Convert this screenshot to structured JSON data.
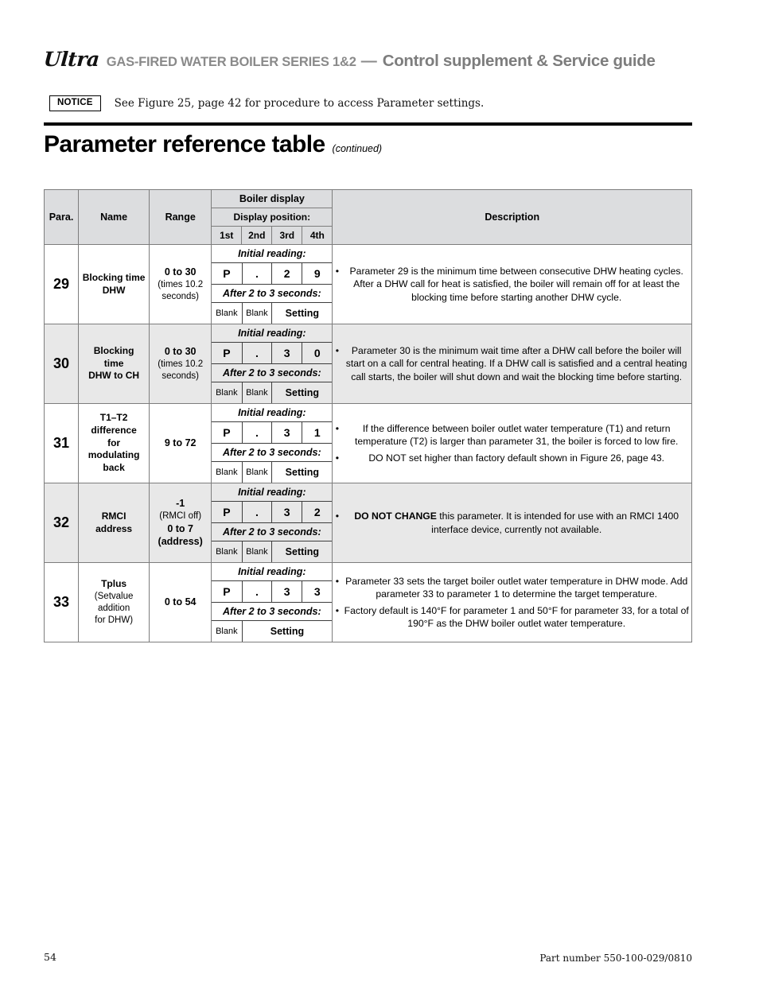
{
  "header": {
    "brand": "Ultra",
    "product_line": "GAS-FIRED WATER BOILER SERIES 1&2",
    "dash": "—",
    "guide_title": "Control supplement & Service guide"
  },
  "notice": {
    "badge": "NOTICE",
    "text": "See Figure 25, page 42 for procedure to access Parameter settings."
  },
  "page_title": {
    "main": "Parameter reference table",
    "continued": "(continued)"
  },
  "table": {
    "headers": {
      "para": "Para.",
      "name": "Name",
      "range": "Range",
      "boiler_display": "Boiler display",
      "display_position": "Display position:",
      "pos1": "1st",
      "pos2": "2nd",
      "pos3": "3rd",
      "pos4": "4th",
      "description": "Description"
    },
    "labels": {
      "initial_reading": "Initial reading:",
      "after_seconds": "After 2 to 3 seconds:",
      "blank": "Blank",
      "setting": "Setting"
    },
    "rows": [
      {
        "para": "29",
        "name_lines": [
          "Blocking time",
          "DHW"
        ],
        "range_lines": [
          {
            "text": "0 to 30",
            "style": "bold"
          },
          {
            "text": "(times 10.2",
            "style": "light"
          },
          {
            "text": "seconds)",
            "style": "light"
          }
        ],
        "digits": [
          "P",
          ".",
          "2",
          "9"
        ],
        "setting_row": [
          "Blank",
          "Blank",
          "Setting"
        ],
        "setting_span": 2,
        "shaded": false,
        "description": [
          {
            "bullet": true,
            "text": "Parameter 29 is the minimum time between consecutive DHW heating cycles. After a DHW call for heat is satisfied, the boiler will remain off for at least the blocking time before starting another DHW cycle."
          }
        ]
      },
      {
        "para": "30",
        "name_lines": [
          "Blocking",
          "time",
          "DHW to CH"
        ],
        "range_lines": [
          {
            "text": "0 to 30",
            "style": "bold"
          },
          {
            "text": "(times 10.2",
            "style": "light"
          },
          {
            "text": "seconds)",
            "style": "light"
          }
        ],
        "digits": [
          "P",
          ".",
          "3",
          "0"
        ],
        "setting_row": [
          "Blank",
          "Blank",
          "Setting"
        ],
        "setting_span": 2,
        "shaded": true,
        "description": [
          {
            "bullet": true,
            "text": "Parameter 30 is the minimum wait time after a DHW call before the boiler will start on a call for central heating. If a DHW call is satisfied and a central heating call starts, the boiler will shut down and wait the blocking time before starting."
          }
        ]
      },
      {
        "para": "31",
        "name_lines": [
          "T1–T2",
          "difference",
          "for",
          "modulating",
          "back"
        ],
        "range_lines": [
          {
            "text": "9 to 72",
            "style": "bold"
          }
        ],
        "digits": [
          "P",
          ".",
          "3",
          "1"
        ],
        "setting_row": [
          "Blank",
          "Blank",
          "Setting"
        ],
        "setting_span": 2,
        "shaded": false,
        "description": [
          {
            "bullet": true,
            "text": "If the difference between boiler outlet water temperature (T1) and return temperature (T2) is larger than parameter 31, the boiler is forced to low fire."
          },
          {
            "bullet": true,
            "text": "DO NOT set higher than factory default shown in Figure 26, page 43."
          }
        ]
      },
      {
        "para": "32",
        "name_lines": [
          "RMCI",
          "address"
        ],
        "range_lines": [
          {
            "text": "-1",
            "style": "bold"
          },
          {
            "text": "(RMCI off)",
            "style": "light"
          },
          {
            "text": "0 to 7",
            "style": "bold"
          },
          {
            "text": "(address)",
            "style": "bold"
          }
        ],
        "digits": [
          "P",
          ".",
          "3",
          "2"
        ],
        "setting_row": [
          "Blank",
          "Blank",
          "Setting"
        ],
        "setting_span": 2,
        "shaded": true,
        "description": [
          {
            "bullet": true,
            "bold_lead": "DO NOT CHANGE",
            "text": " this parameter. It is intended for use with an RMCI 1400 interface device, currently not available."
          }
        ]
      },
      {
        "para": "33",
        "name_lines": [
          "Tplus",
          "(Setvalue",
          "addition",
          "for DHW)"
        ],
        "name_styles": [
          "bold",
          "light",
          "light",
          "light"
        ],
        "range_lines": [
          {
            "text": "0 to 54",
            "style": "bold"
          }
        ],
        "digits": [
          "P",
          ".",
          "3",
          "3"
        ],
        "setting_row": [
          "Blank",
          "Setting"
        ],
        "setting_span": 3,
        "shaded": false,
        "description": [
          {
            "bullet": true,
            "text": "Parameter 33 sets the target boiler outlet water temperature in DHW mode. Add parameter 33 to parameter 1 to determine the target temperature."
          },
          {
            "bullet": true,
            "text": "Factory default is 140°F for parameter 1 and 50°F for parameter 33, for a total of 190°F as the DHW boiler outlet water temperature."
          }
        ]
      }
    ]
  },
  "footer": {
    "page_number": "54",
    "part_number": "Part number 550-100-029/0810"
  }
}
